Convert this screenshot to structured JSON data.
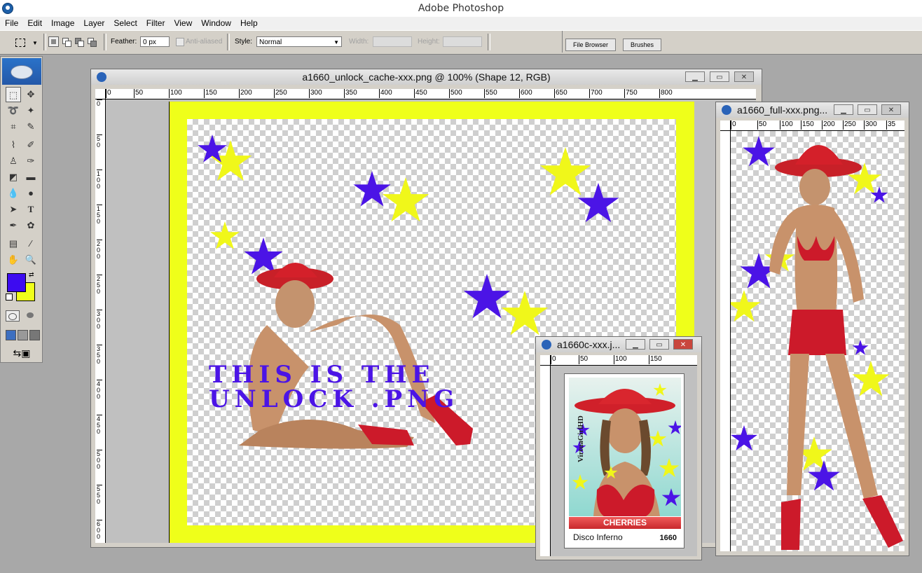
{
  "app": {
    "title": "Adobe Photoshop"
  },
  "menu": [
    "File",
    "Edit",
    "Image",
    "Layer",
    "Select",
    "Filter",
    "View",
    "Window",
    "Help"
  ],
  "options": {
    "feather_label": "Feather:",
    "feather_value": "0 px",
    "antialias_label": "Anti-aliased",
    "style_label": "Style:",
    "style_value": "Normal",
    "width_label": "Width:",
    "height_label": "Height:"
  },
  "palette_well": {
    "tabs": [
      "File Browser",
      "Brushes"
    ]
  },
  "colors": {
    "foreground": "#3d0bf0",
    "background": "#efff1a",
    "frame_yellow": "#efff1a",
    "star_blue": "#4b14e6",
    "star_yellow": "#f0f71a"
  },
  "windows": {
    "main": {
      "title": "a1660_unlock_cache-xxx.png @ 100% (Shape 12, RGB)",
      "ruler_h": [
        "0",
        "50",
        "100",
        "150",
        "200",
        "250",
        "300",
        "350",
        "400",
        "450",
        "500",
        "550",
        "600",
        "650",
        "700",
        "750",
        "800"
      ],
      "ruler_v": [
        "0",
        "5 0",
        "1 0 0",
        "1 5 0",
        "2 0 0",
        "2 5 0",
        "3 0 0",
        "3 5 0",
        "4 0 0",
        "4 5 0",
        "5 0 0",
        "5 5 0",
        "6 0 0"
      ],
      "overlay_text_line1": "THIS IS THE",
      "overlay_text_line2": "UNLOCK .PNG"
    },
    "full": {
      "title": "a1660_full-xxx.png...",
      "ruler_h": [
        "0",
        "50",
        "100",
        "150",
        "200",
        "250",
        "300",
        "35"
      ]
    },
    "card": {
      "title": "a1660c-xxx.j...",
      "ruler_h": [
        "0",
        "50",
        "100",
        "150"
      ],
      "brand": "VirtuaGirlHD",
      "label": "CHERRIES",
      "name": "Disco Inferno",
      "number": "1660"
    }
  }
}
